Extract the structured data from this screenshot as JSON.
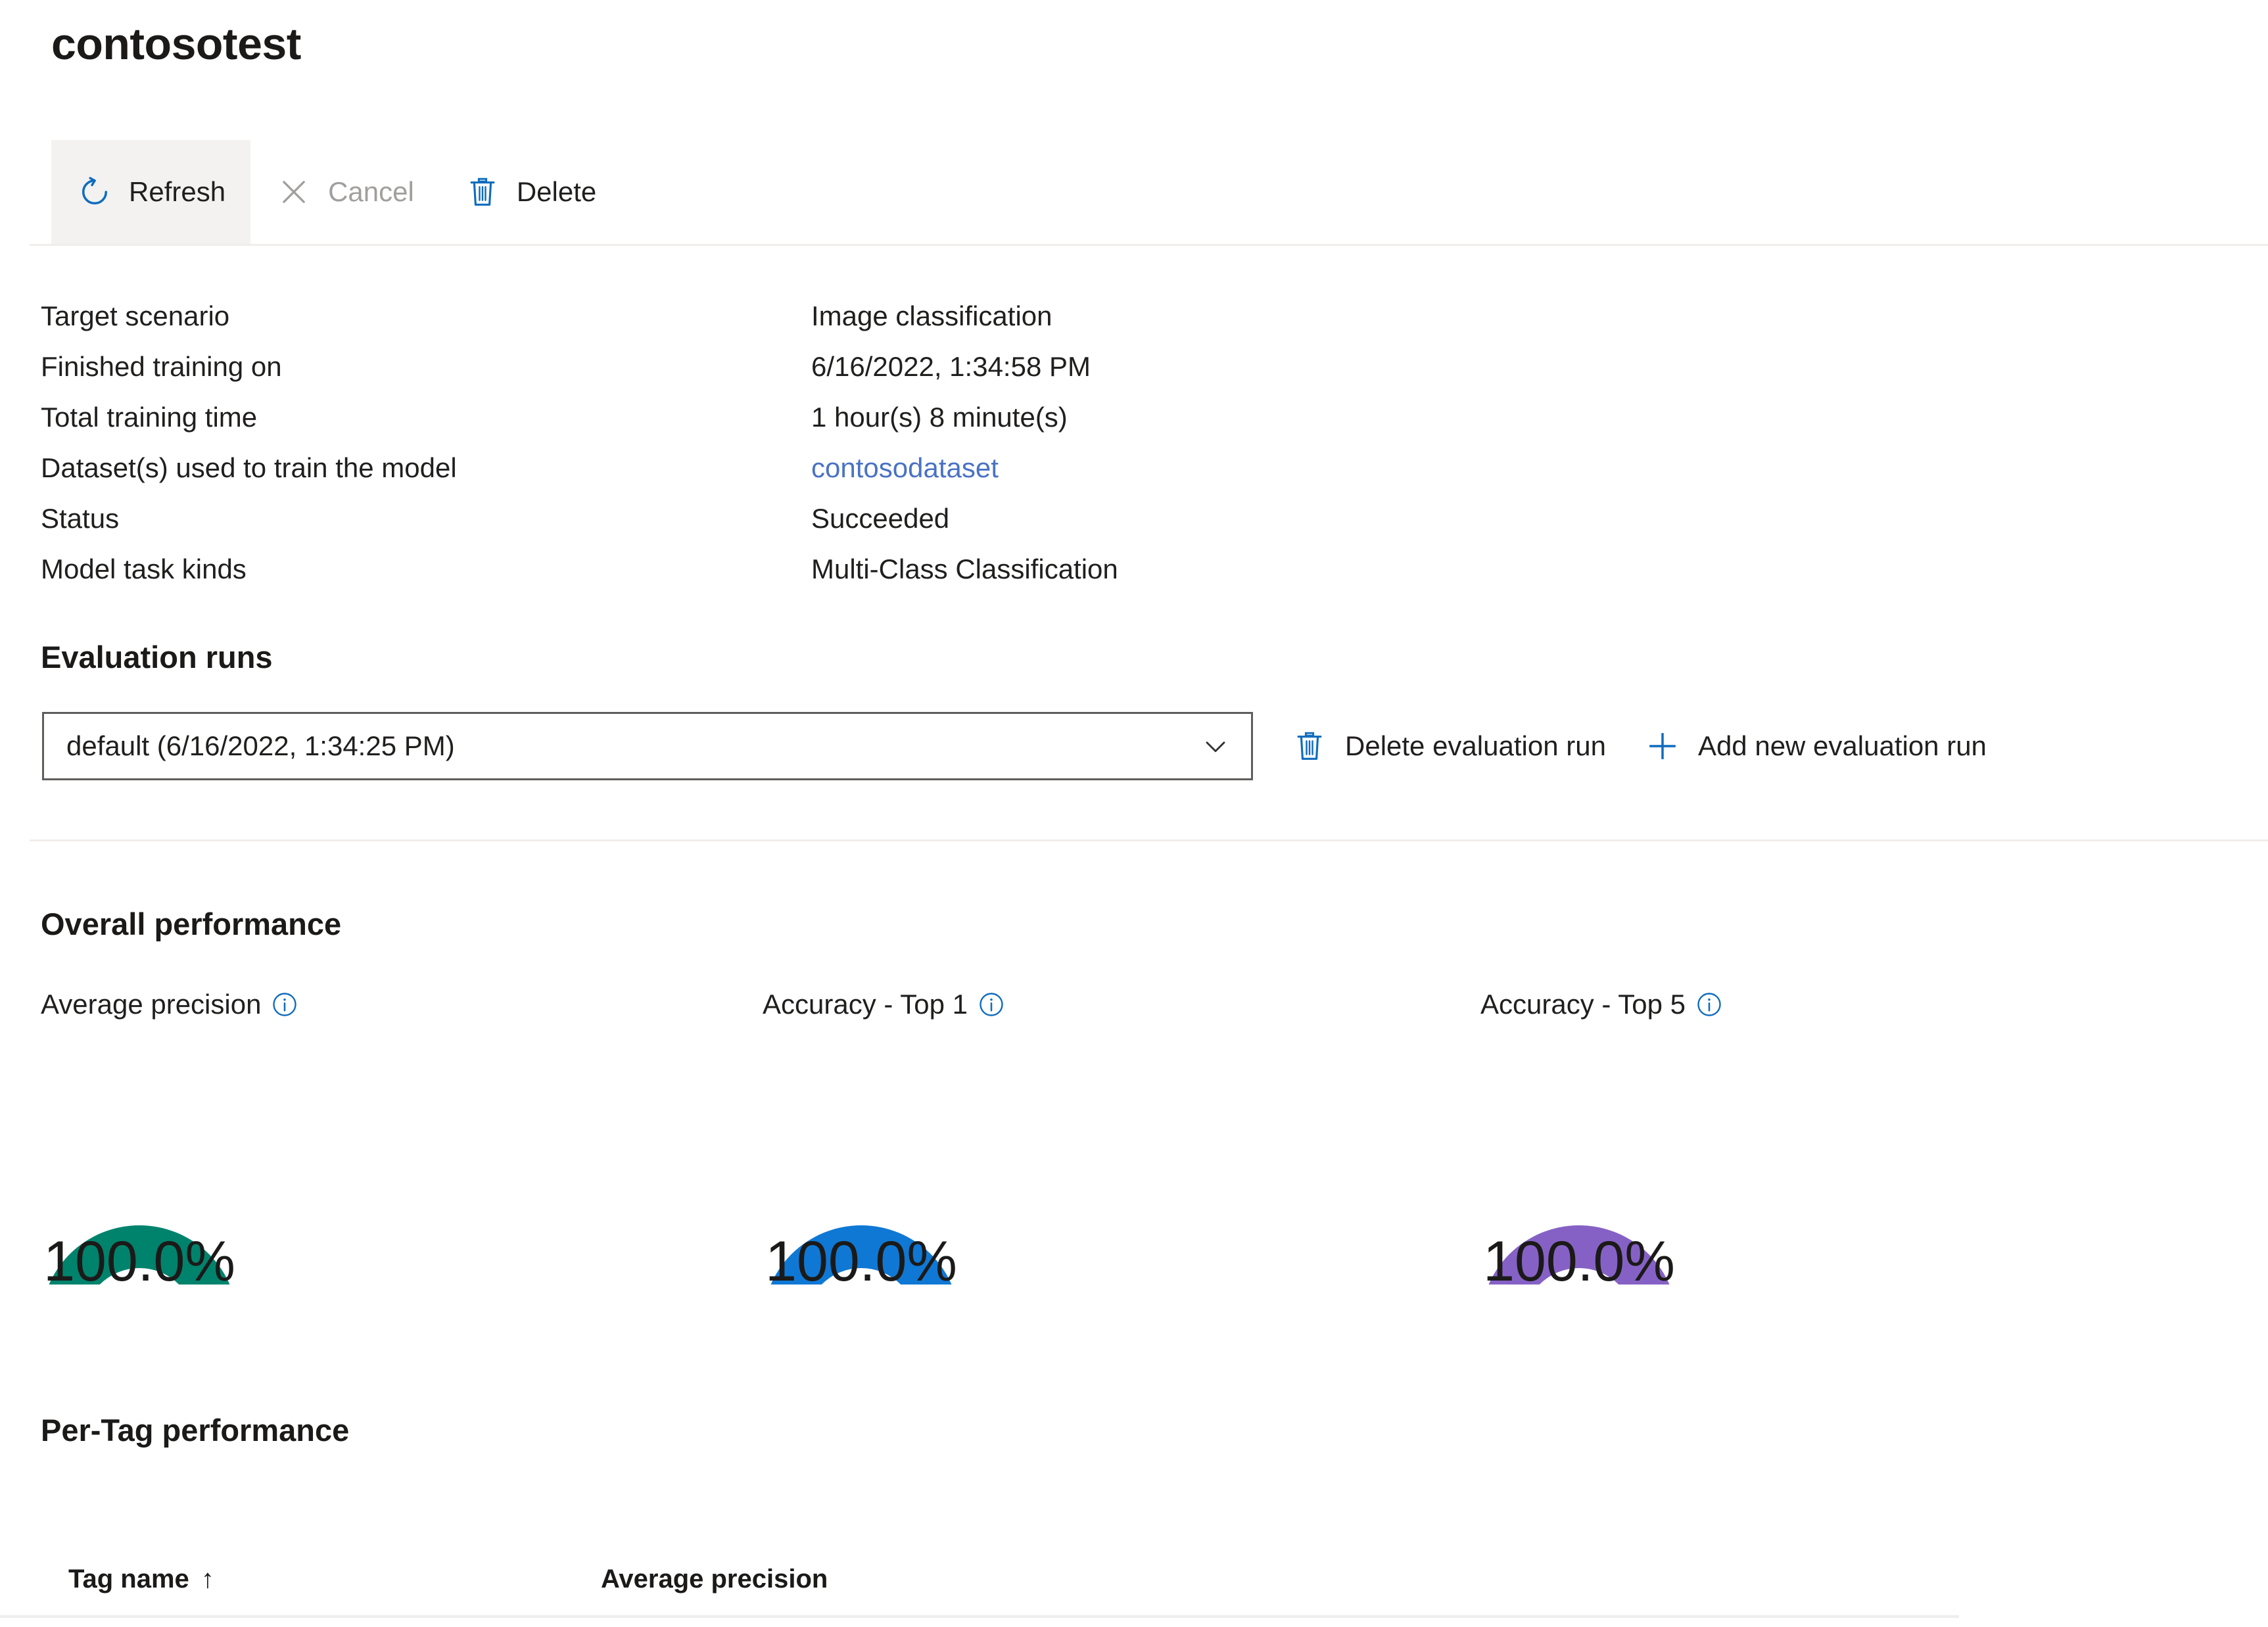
{
  "page": {
    "title": "contosotest"
  },
  "toolbar": {
    "refresh_label": "Refresh",
    "cancel_label": "Cancel",
    "delete_label": "Delete"
  },
  "details": {
    "rows": [
      {
        "key": "Target scenario",
        "value": "Image classification",
        "is_link": false
      },
      {
        "key": "Finished training on",
        "value": "6/16/2022, 1:34:58 PM",
        "is_link": false
      },
      {
        "key": "Total training time",
        "value": "1 hour(s) 8 minute(s)",
        "is_link": false
      },
      {
        "key": "Dataset(s) used to train the model",
        "value": "contosodataset",
        "is_link": true
      },
      {
        "key": "Status",
        "value": "Succeeded",
        "is_link": false
      },
      {
        "key": "Model task kinds",
        "value": "Multi-Class Classification",
        "is_link": false
      }
    ]
  },
  "evaluation_runs": {
    "heading": "Evaluation runs",
    "selected_run": "default (6/16/2022, 1:34:25 PM)",
    "delete_run_label": "Delete evaluation run",
    "add_run_label": "Add new evaluation run"
  },
  "overall_performance": {
    "heading": "Overall performance",
    "gauges": [
      {
        "label": "Average precision",
        "value": "100.0%",
        "percent": 100,
        "color": "#00836D"
      },
      {
        "label": "Accuracy - Top 1",
        "value": "100.0%",
        "percent": 100,
        "color": "#0F78D4"
      },
      {
        "label": "Accuracy - Top 5",
        "value": "100.0%",
        "percent": 100,
        "color": "#8661C5"
      }
    ]
  },
  "per_tag_performance": {
    "heading": "Per-Tag performance",
    "columns": [
      {
        "label": "Tag name",
        "sort": "↑"
      },
      {
        "label": "Average precision",
        "sort": ""
      }
    ],
    "rows": []
  },
  "colors": {
    "accent_blue": "#0F6CBD",
    "link_blue": "#4a72c4",
    "text": "#201f1e",
    "disabled": "#a19f9d",
    "divider": "#f0eeec",
    "hover_bg": "#f3f2f1"
  },
  "chart_data": {
    "type": "pie",
    "title": "Overall performance",
    "categories": [
      "Average precision",
      "Accuracy - Top 1",
      "Accuracy - Top 5"
    ],
    "values": [
      100.0,
      100.0,
      100.0
    ],
    "unit": "%",
    "ylim": [
      0,
      100
    ],
    "legend": "none",
    "grid": false
  }
}
